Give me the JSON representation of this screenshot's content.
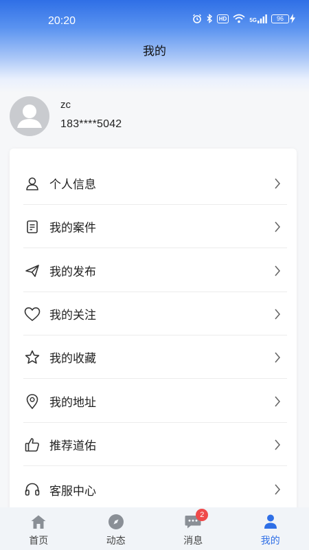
{
  "status_bar": {
    "time": "20:20",
    "hd": "HD",
    "network": "5G",
    "battery": "96"
  },
  "header": {
    "title": "我的"
  },
  "profile": {
    "name": "zc",
    "phone": "183****5042"
  },
  "menu": {
    "items": [
      {
        "label": "个人信息",
        "icon": "user-icon"
      },
      {
        "label": "我的案件",
        "icon": "document-icon"
      },
      {
        "label": "我的发布",
        "icon": "paper-plane-icon"
      },
      {
        "label": "我的关注",
        "icon": "heart-icon"
      },
      {
        "label": "我的收藏",
        "icon": "star-icon"
      },
      {
        "label": "我的地址",
        "icon": "location-pin-icon"
      },
      {
        "label": "推荐道佑",
        "icon": "thumbs-up-icon"
      },
      {
        "label": "客服中心",
        "icon": "headset-icon"
      }
    ]
  },
  "tabbar": {
    "tabs": [
      {
        "label": "首页",
        "icon": "home-icon"
      },
      {
        "label": "动态",
        "icon": "compass-icon"
      },
      {
        "label": "消息",
        "icon": "chat-icon",
        "badge": "2"
      },
      {
        "label": "我的",
        "icon": "person-icon"
      }
    ],
    "active": "我的"
  },
  "colors": {
    "accent": "#2f6fe6",
    "badge": "#ef4a4a",
    "text": "#222222"
  }
}
